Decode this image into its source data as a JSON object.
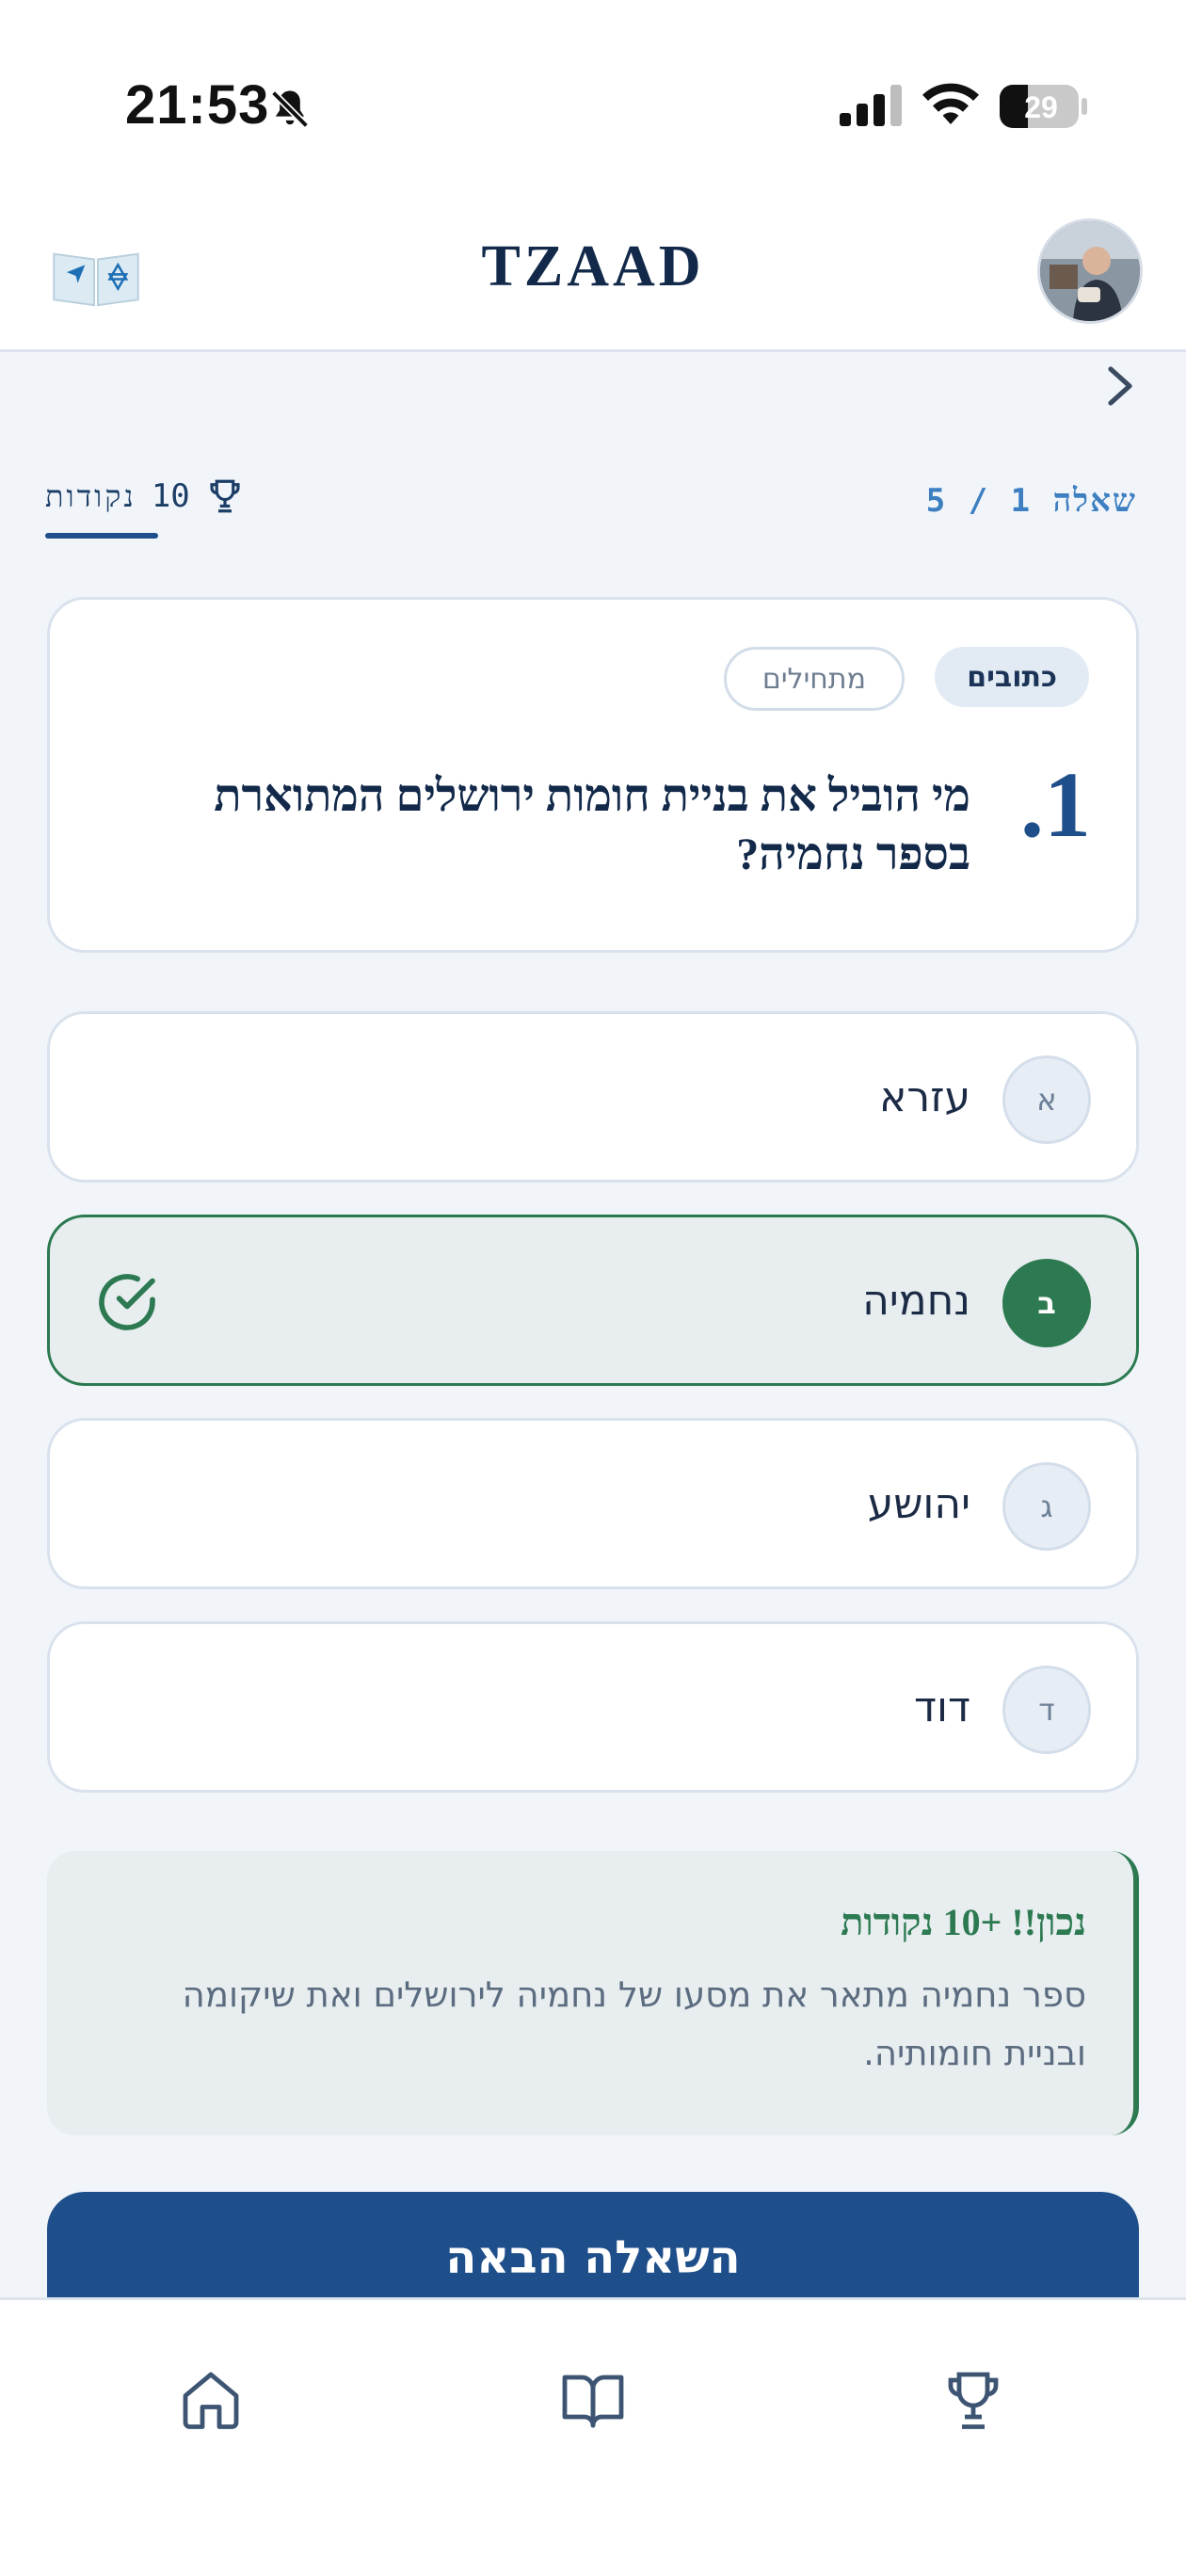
{
  "status_bar": {
    "time": "21:53",
    "battery": "29",
    "icons": [
      "bell-muted-icon",
      "signal-icon",
      "wifi-icon",
      "battery-icon"
    ]
  },
  "header": {
    "title": "TZAAD",
    "logo_icon": "book-star-icon",
    "avatar_icon": "user-avatar"
  },
  "navigation": {
    "back_icon": "chevron-right-icon"
  },
  "quiz": {
    "counter": "שאלה 1 / 5",
    "points_value": "10",
    "points_label": "נקודות",
    "tags": [
      "כתובים",
      "מתחילים"
    ],
    "question_number": "1.",
    "question_text": "מי הוביל את בניית חומות ירושלים המתוארת בספר נחמיה?",
    "options": [
      {
        "letter": "א",
        "text": "עזרא",
        "state": "default"
      },
      {
        "letter": "ב",
        "text": "נחמיה",
        "state": "correct"
      },
      {
        "letter": "ג",
        "text": "יהושע",
        "state": "default"
      },
      {
        "letter": "ד",
        "text": "דוד",
        "state": "default"
      }
    ]
  },
  "feedback": {
    "title": "נכון!! +10 נקודות",
    "text": "ספר נחמיה מתאר את מסעו של נחמיה לירושלים ואת שיקומה ובניית חומותיה."
  },
  "next_button": {
    "label": "השאלה הבאה"
  },
  "bottom_nav": {
    "items": [
      "home-icon",
      "book-icon",
      "trophy-icon"
    ]
  },
  "colors": {
    "primary": "#1f4f8a",
    "success": "#2d7a52",
    "background": "#f1f5fa"
  }
}
